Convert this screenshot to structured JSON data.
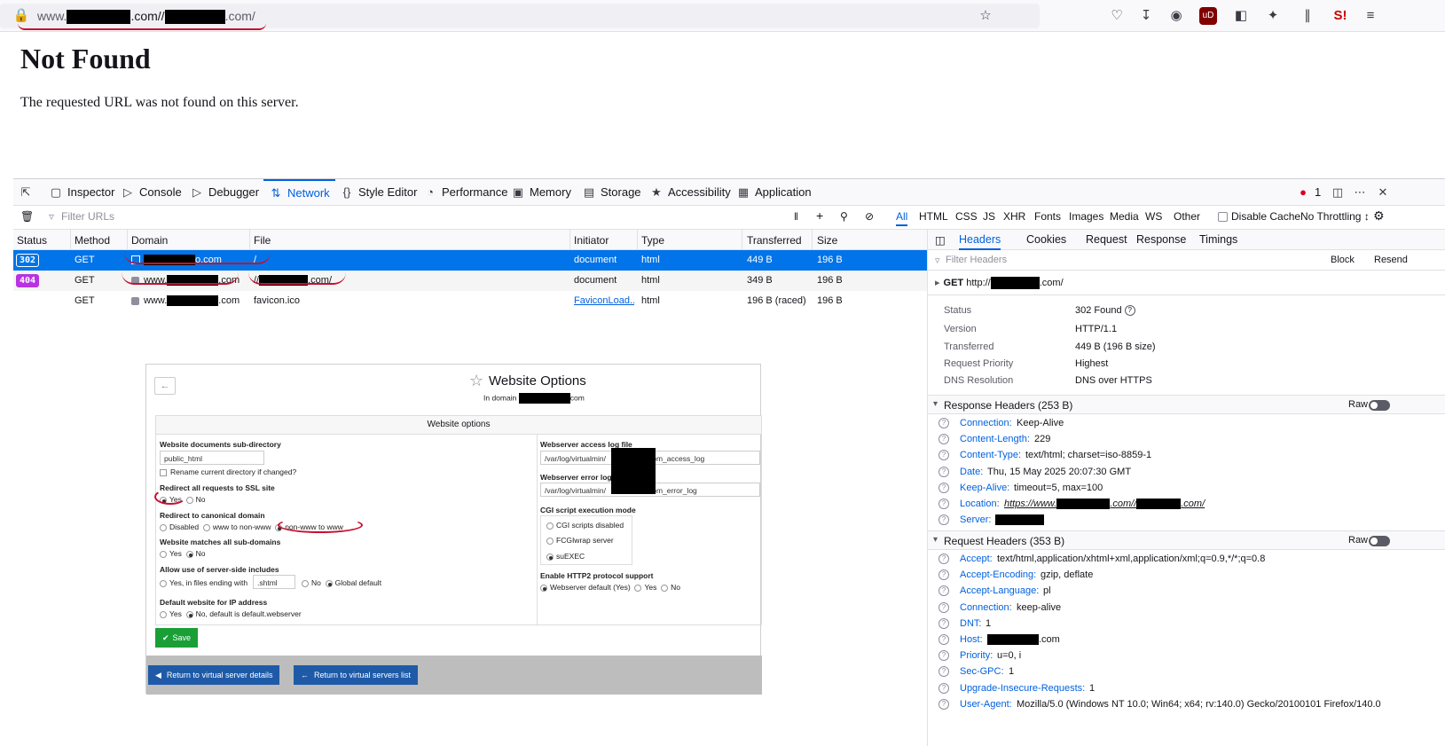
{
  "browser": {
    "url_prefix": "www.",
    "url_mid": ".com//",
    "url_suffix": ".com/",
    "icons": [
      "lock-icon",
      "star-icon",
      "pocket-icon",
      "download-icon",
      "account-icon",
      "ublock-icon",
      "extensions-icon",
      "sidebar-icon",
      "s-icon",
      "menu-icon"
    ]
  },
  "page": {
    "title": "Not Found",
    "message": "The requested URL was not found on this server."
  },
  "devtools": {
    "tabs": [
      "Inspector",
      "Console",
      "Debugger",
      "Network",
      "Style Editor",
      "Performance",
      "Memory",
      "Storage",
      "Accessibility",
      "Application"
    ],
    "active_tab": "Network",
    "error_count": "1",
    "filter_placeholder": "Filter URLs",
    "type_filters": [
      "All",
      "HTML",
      "CSS",
      "JS",
      "XHR",
      "Fonts",
      "Images",
      "Media",
      "WS",
      "Other"
    ],
    "disable_cache": "Disable Cache",
    "throttling": "No Throttling ↕"
  },
  "requests": {
    "columns": [
      "Status",
      "Method",
      "Domain",
      "File",
      "Initiator",
      "Type",
      "Transferred",
      "Size"
    ],
    "rows": [
      {
        "status": "302",
        "method": "GET",
        "domain_suffix": "o.com",
        "file": "/",
        "initiator": "document",
        "type": "html",
        "transferred": "449 B",
        "size": "196 B"
      },
      {
        "status": "404",
        "method": "GET",
        "domain_prefix": "www.",
        "domain_suffix": ".com",
        "file_prefix": "//",
        "file_suffix": ".com/",
        "initiator": "document",
        "type": "html",
        "transferred": "349 B",
        "size": "196 B"
      },
      {
        "status": "",
        "method": "GET",
        "domain_prefix": "www.",
        "domain_suffix": ".com",
        "file": "favicon.ico",
        "initiator": "FaviconLoad...",
        "type": "html",
        "transferred": "196 B (raced)",
        "size": "196 B"
      }
    ]
  },
  "sidebar": {
    "tabs": [
      "Headers",
      "Cookies",
      "Request",
      "Response",
      "Timings"
    ],
    "filter_placeholder": "Filter Headers",
    "block": "Block",
    "resend": "Resend",
    "request_line_method": "GET",
    "request_line_prefix": "http://",
    "request_line_suffix": ".com/",
    "summary": [
      {
        "k": "Status",
        "v": "302 Found"
      },
      {
        "k": "Version",
        "v": "HTTP/1.1"
      },
      {
        "k": "Transferred",
        "v": "449 B (196 B size)"
      },
      {
        "k": "Request Priority",
        "v": "Highest"
      },
      {
        "k": "DNS Resolution",
        "v": "DNS over HTTPS"
      }
    ],
    "response_title": "Response Headers (253 B)",
    "request_title": "Request Headers (353 B)",
    "raw": "Raw",
    "response_headers": [
      {
        "n": "Connection:",
        "v": "Keep-Alive"
      },
      {
        "n": "Content-Length:",
        "v": "229"
      },
      {
        "n": "Content-Type:",
        "v": "text/html; charset=iso-8859-1"
      },
      {
        "n": "Date:",
        "v": "Thu, 15 May 2025 20:07:30 GMT"
      },
      {
        "n": "Keep-Alive:",
        "v": "timeout=5, max=100"
      },
      {
        "n": "Location:",
        "v": "https://www."
      },
      {
        "n": "Server:",
        "v": ""
      }
    ],
    "location_mid": ".com//",
    "location_end": ".com/",
    "request_headers": [
      {
        "n": "Accept:",
        "v": "text/html,application/xhtml+xml,application/xml;q=0.9,*/*;q=0.8"
      },
      {
        "n": "Accept-Encoding:",
        "v": "gzip, deflate"
      },
      {
        "n": "Accept-Language:",
        "v": "pl"
      },
      {
        "n": "Connection:",
        "v": "keep-alive"
      },
      {
        "n": "DNT:",
        "v": "1"
      },
      {
        "n": "Host:",
        "v": ".com"
      },
      {
        "n": "Priority:",
        "v": "u=0, i"
      },
      {
        "n": "Sec-GPC:",
        "v": "1"
      },
      {
        "n": "Upgrade-Insecure-Requests:",
        "v": "1"
      },
      {
        "n": "User-Agent:",
        "v": "Mozilla/5.0 (Windows NT 10.0; Win64; x64; rv:140.0) Gecko/20100101 Firefox/140.0"
      }
    ]
  },
  "vm": {
    "title": "Website Options",
    "subtitle_prefix": "In domain",
    "subtitle_suffix": "com",
    "section": "Website options",
    "docs_label": "Website documents sub-directory",
    "docs_value": "public_html",
    "rename_label": "Rename current directory if changed?",
    "ssl_label": "Redirect all requests to SSL site",
    "yes": "Yes",
    "no": "No",
    "canon_label": "Redirect to canonical domain",
    "canon_disabled": "Disabled",
    "canon_www_to_non": "www to non-www",
    "canon_non_to_www": "non-www to www",
    "subdomains_label": "Website matches all sub-domains",
    "ssi_label": "Allow use of server-side includes",
    "ssi_yes": "Yes, in files ending with",
    "ssi_ext": ".shtml",
    "ssi_global": "Global default",
    "default_label": "Default website for IP address",
    "default_no": "No, default is default.webserver",
    "access_log_label": "Webserver access log file",
    "access_log_prefix": "/var/log/virtualmin/",
    "access_log_suffix": "com_access_log",
    "error_log_label": "Webserver error log",
    "error_log_prefix": "/var/log/virtualmin/",
    "error_log_suffix": "com_error_log",
    "cgi_label": "CGI script execution mode",
    "cgi_options": [
      "CGI scripts disabled",
      "FCGIwrap server",
      "suEXEC"
    ],
    "http2_label": "Enable HTTP2 protocol support",
    "http2_default": "Webserver default (Yes)",
    "save": "Save",
    "return_details": "Return to virtual server details",
    "return_list": "Return to virtual servers list"
  },
  "colors": {
    "accent": "#0060df",
    "selected_row": "#0074e8",
    "badge_404": "#b833e1",
    "save_green": "#1a9f36",
    "vm_blue": "#1e5aa8",
    "annotation_red": "#c8102e"
  }
}
